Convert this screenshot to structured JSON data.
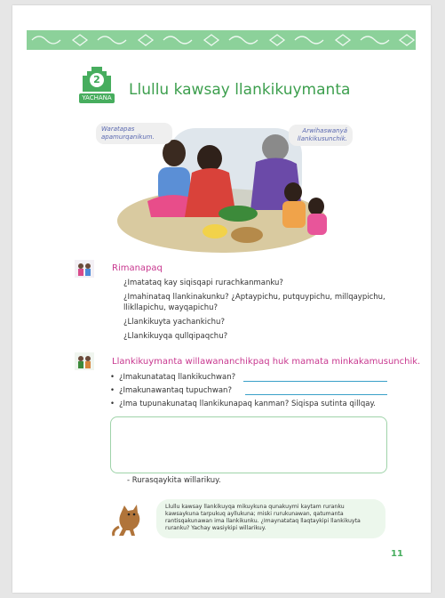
{
  "header": {
    "badge_number": "2",
    "badge_label": "YACHANA",
    "title": "Llullu kawsay llankikuymanta"
  },
  "illustration": {
    "bubble_left": "Waratapas apamurqanikum.",
    "bubble_right": "Arwihaswanyá llankikusunchik."
  },
  "rimanapaq": {
    "title": "Rimanapaq",
    "questions": [
      "¿Imatataq kay siqisqapi rurachkanmanku?",
      "¿Imahinataq llankinakunku? ¿Aptaypichu, putquypichu, millqaypichu, llikllapichu, wayqapichu?",
      "¿Llankikuyta yachankichu?",
      "¿Llankikuyqa qullqipaqchu?"
    ]
  },
  "activity": {
    "title": "Llankikuymanta willawananchikpaq huk mamata minkakamusunchik.",
    "bullets": [
      "¿Imakunatataq llankikuchwan?",
      "¿Imakunawantaq tupuchwan?",
      "¿Ima tupunakunataq llankikunapaq kanman? Siqispa sutinta qillqay."
    ],
    "signature": "- Rurasqaykita willarikuy."
  },
  "note": {
    "text": "Llullu kawsay llankikuyqa mikuykuna qunakuymi kaytam ruranku kawsaykuna tarpukuq ayllukuna; miski rurukunawan, qatumanta rantisqakunawan ima llankikunku. ¿Imaynatataq llaqtaykipi llankikuyta ruranku? Yachay wasiykipi willarikuy."
  },
  "page_number": "11",
  "colors": {
    "green": "#47ad5e",
    "magenta": "#c8388f",
    "band": "#8cd19a"
  }
}
